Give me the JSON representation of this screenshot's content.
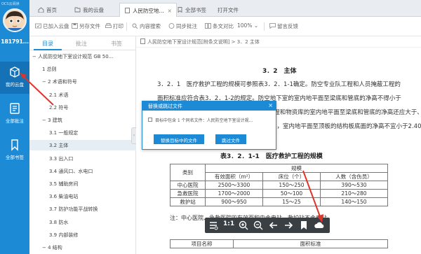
{
  "app": {
    "title": "OCS云阅读",
    "username": "181791..."
  },
  "sidebar": {
    "items": [
      {
        "label": "我的云盘",
        "icon": "cloud-drive-icon"
      },
      {
        "label": "全部批注",
        "icon": "annotation-icon"
      },
      {
        "label": "全部书签",
        "icon": "bookmark-icon"
      }
    ]
  },
  "tabs": [
    {
      "label": "首页",
      "icon": "home-icon"
    },
    {
      "label": "我的云盘",
      "icon": "folder-icon"
    },
    {
      "label": "人民防空地...",
      "icon": "document-icon",
      "close": "×"
    },
    {
      "label": "全部书签",
      "icon": "bookmark-icon"
    },
    {
      "label": "打开文件"
    }
  ],
  "toolbar": {
    "add_to_cloud": "已加入云盘",
    "save_as": "另存文件",
    "print": "打印",
    "content_search": "内容搜索",
    "sync_comments": "同步批注",
    "compare": "条文对比",
    "zoom": "100%",
    "zoom_arrow": "⌄",
    "feedback": "留言反馈"
  },
  "outline": {
    "tabs": [
      "目录",
      "批注",
      "书签"
    ],
    "collapse_glyph": "‹",
    "items": [
      {
        "text": "− 人民防空地下室设计规范 GB 50...",
        "selected": false
      },
      {
        "text": "1 总则",
        "selected": false
      },
      {
        "text": "− 2 术语和符号",
        "selected": false
      },
      {
        "text": "2.1 术语",
        "selected": false
      },
      {
        "text": "2.2 符号",
        "selected": false
      },
      {
        "text": "− 3 建筑",
        "selected": false
      },
      {
        "text": "3.1 一般规定",
        "selected": false
      },
      {
        "text": "3.2 主体",
        "selected": true
      },
      {
        "text": "3.3 出入口",
        "selected": false
      },
      {
        "text": "3.4 通风口、水电口",
        "selected": false
      },
      {
        "text": "3.5 辅助房间",
        "selected": false
      },
      {
        "text": "3.6 柴油电站",
        "selected": false
      },
      {
        "text": "3.7 防护功能平战转换",
        "selected": false
      },
      {
        "text": "3.8 防水",
        "selected": false
      },
      {
        "text": "3.9 内部装修",
        "selected": false
      },
      {
        "text": "− 4 结构",
        "selected": false
      }
    ]
  },
  "document": {
    "breadcrumb": "人民防空地下室设计规范[附条文说明] > 3．2 主体",
    "section_title": "3．2　主体",
    "paragraphs": [
      "3．2．1　医疗救护工程的规模可参照表3．2．1-1确定。防空专业队工程和人员掩蔽工程的",
      "面积标准应符合表3．2．1-2的规定。防空地下室的室内地平面至梁底和管底的净高不得小于",
      "2.0m，其中专业队队员掩蔽部、人员掩蔽工程和物资库的室内地平面至梁底和管底的净高还应大于、等",
      "于2.2m。柴油发电机房（专业队队员掩蔽部），室内地平面至顶板的结构板底面的净高不宜小于2.40m（专业"
    ],
    "table_caption": "表3．2．1-1　医疗救护工程的规模",
    "table": {
      "header_type": "类别",
      "header_scale": "规模",
      "header_area": "有效面积（m²）",
      "header_beds": "床位（个）",
      "header_people": "人数（含伤员）",
      "rows": [
        [
          "中心医院",
          "2500～3300",
          "150～250",
          "390～530"
        ],
        [
          "急救医院",
          "1700～2000",
          "50～100",
          "210～280"
        ],
        [
          "救护站",
          "900～950",
          "15～25",
          "140～150"
        ]
      ]
    },
    "note": "注：中心医院、急救医院的有效面积中含电站，救护站不含电站。",
    "table2": {
      "caption": "面积标准",
      "col1": "项目名称",
      "col2": "面积标准"
    }
  },
  "modal": {
    "title": "替换或跳过文件",
    "close": "×",
    "message": "目标中包含 1 个同名文件：人民防空地下室设计规...",
    "replace_button": "替换目标中的文件",
    "skip_button": "跳过文件"
  },
  "floatbar": {
    "icons": [
      "toc-icon",
      "fit-page-icon",
      "zoom-in-icon",
      "zoom-out-icon",
      "prev-page-icon",
      "next-page-icon",
      "bookmark-icon",
      "cloud-save-icon"
    ],
    "fit_label": "1:1"
  },
  "colors": {
    "brand": "#1d8ad6",
    "sidebar": "#1d8ad6",
    "annotation": "#e0342a"
  }
}
